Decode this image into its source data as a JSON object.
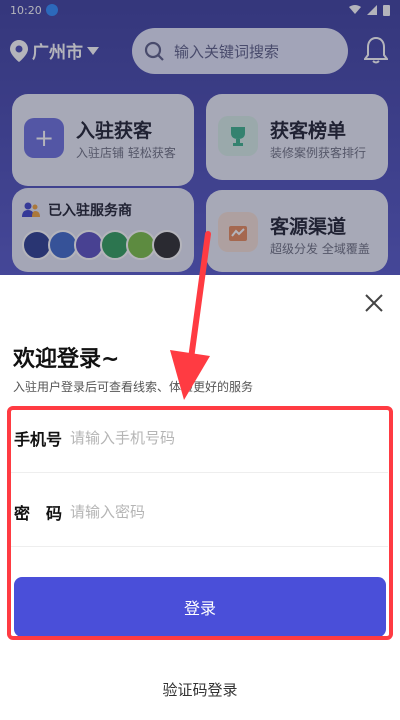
{
  "status_bar": {
    "time": "10:20",
    "notification_glyph": "🅘"
  },
  "header": {
    "city": "广州市",
    "search_placeholder": "输入关键词搜索"
  },
  "cards": {
    "join": {
      "title": "入驻获客",
      "subtitle": "入驻店铺 轻松获客",
      "icon": "plus-icon"
    },
    "rank": {
      "title": "获客榜单",
      "subtitle": "装修案例获客排行",
      "icon": "trophy-icon"
    },
    "services": {
      "title": "已入驻服务商",
      "icon": "user-group-icon"
    },
    "source": {
      "title": "客源渠道",
      "subtitle": "超级分发 全域覆盖",
      "icon": "chart-icon"
    }
  },
  "login_sheet": {
    "welcome_title": "欢迎登录~",
    "welcome_subtitle": "入驻用户登录后可查看线索、体验更好的服务",
    "phone": {
      "label": "手机号",
      "placeholder": "请输入手机号码",
      "value": ""
    },
    "password": {
      "label": "密　码",
      "placeholder": "请输入密码",
      "value": ""
    },
    "login_button": "登录",
    "code_login_link": "验证码登录"
  },
  "colors": {
    "brand_blue": "#4a4fd9",
    "highlight_red": "#ff3b42",
    "header_gradient_top": "#3c3f9e"
  }
}
